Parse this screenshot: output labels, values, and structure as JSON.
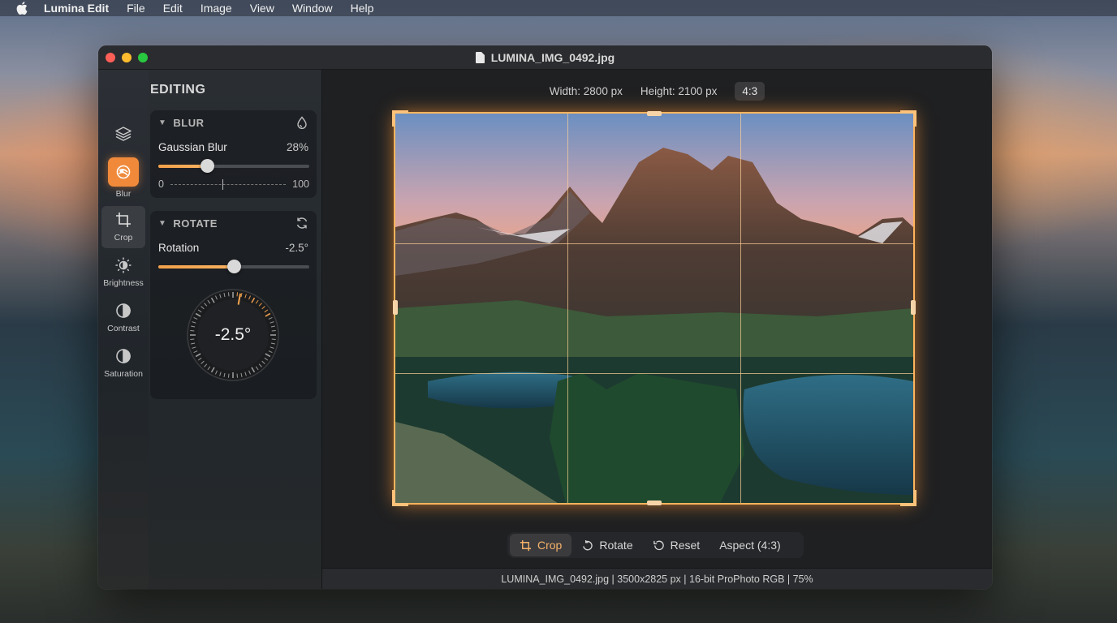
{
  "menubar": {
    "app_name": "Lumina Edit",
    "items": [
      "File",
      "Edit",
      "Image",
      "View",
      "Window",
      "Help"
    ]
  },
  "window": {
    "title": "LUMINA_IMG_0492.jpg"
  },
  "rail": {
    "items": [
      {
        "label": "",
        "icon": "layers-icon"
      },
      {
        "label": "Blur",
        "icon": "blur-icon"
      },
      {
        "label": "Crop",
        "icon": "crop-icon"
      },
      {
        "label": "Brightness",
        "icon": "sun-icon"
      },
      {
        "label": "Contrast",
        "icon": "contrast-icon"
      },
      {
        "label": "Saturation",
        "icon": "saturation-icon"
      }
    ]
  },
  "panel": {
    "title": "EDITING",
    "blur": {
      "header": "BLUR",
      "icon": "droplet-icon",
      "label": "Gaussian Blur",
      "value": "28%",
      "percent": 0.32,
      "range_min": "0",
      "range_max": "100"
    },
    "rotate": {
      "header": "ROTATE",
      "icon": "rotate-icon",
      "label": "Rotation",
      "value": "-2.5°",
      "percent": 0.5,
      "dial_value": "-2.5°"
    }
  },
  "canvas": {
    "width_label": "Width: 2800 px",
    "height_label": "Height: 2100 px",
    "aspect_chip": "4:3"
  },
  "toolbar": {
    "crop": "Crop",
    "rotate": "Rotate",
    "reset": "Reset",
    "aspect": "Aspect (4:3)"
  },
  "status": {
    "text": "LUMINA_IMG_0492.jpg | 3500x2825 px | 16-bit ProPhoto RGB | 75%"
  },
  "colors": {
    "accent": "#f08a3a",
    "crop_glow": "#ffb45c"
  }
}
